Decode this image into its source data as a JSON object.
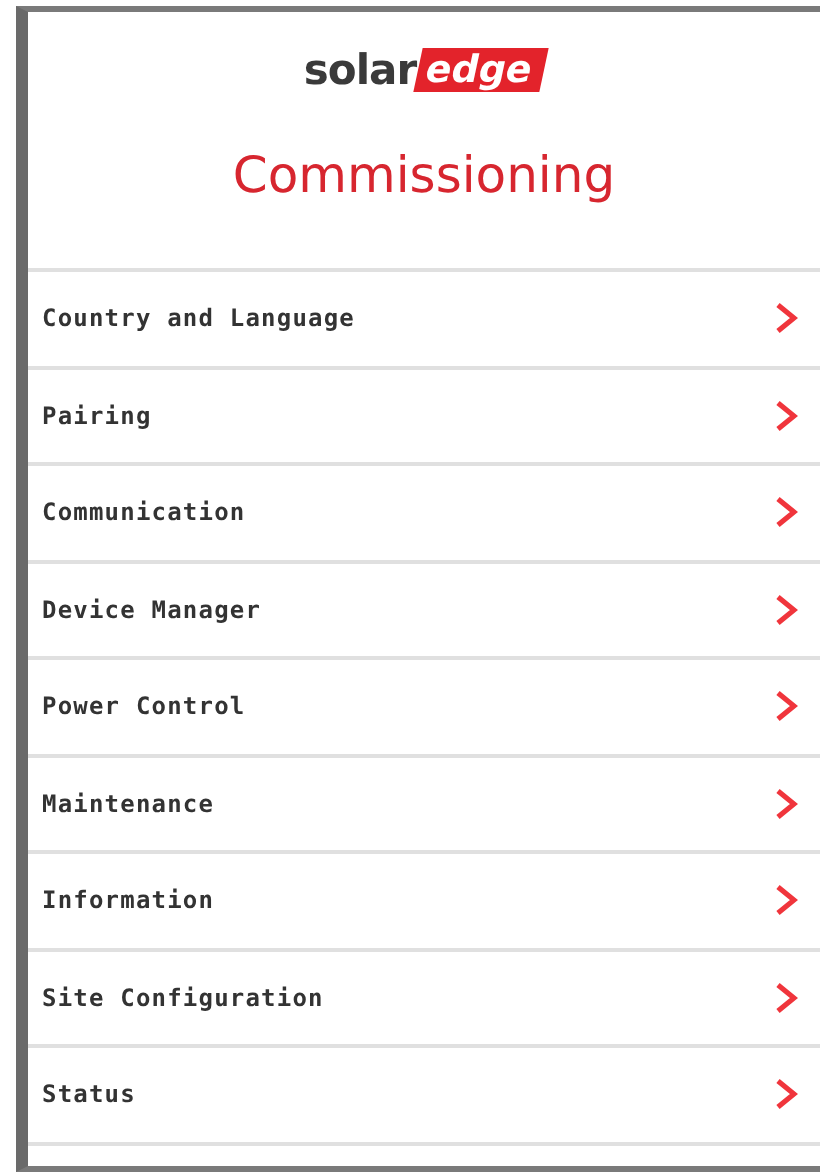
{
  "logo": {
    "text": "solar",
    "highlight": "edge"
  },
  "title": "Commissioning",
  "menu": [
    {
      "label": "Country and Language"
    },
    {
      "label": "Pairing"
    },
    {
      "label": "Communication"
    },
    {
      "label": "Device Manager"
    },
    {
      "label": "Power Control"
    },
    {
      "label": "Maintenance"
    },
    {
      "label": "Information"
    },
    {
      "label": "Site Configuration"
    },
    {
      "label": "Status"
    }
  ]
}
